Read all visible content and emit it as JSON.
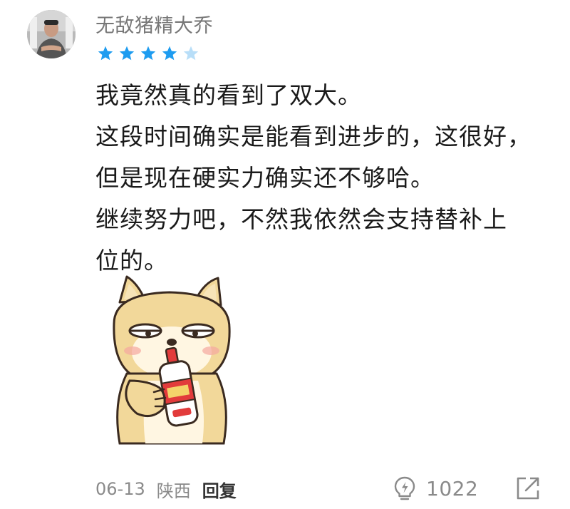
{
  "user": {
    "name": "无敌猪精大乔",
    "rating": 4,
    "max_rating": 5
  },
  "comment": {
    "lines": [
      "我竟然真的看到了双大。",
      "这段时间确实是能看到进步的，这很好，",
      "但是现在硬实力确实还不够哈。",
      "继续努力吧，不然我依然会支持替补上",
      "位的。"
    ]
  },
  "sticker": {
    "icon": "shiba-drinking-sticker"
  },
  "footer": {
    "date": "06-13",
    "location": "陕西",
    "reply_label": "回复",
    "like_count": "1022"
  },
  "colors": {
    "star_filled": "#1e9cf0",
    "star_empty": "#b8def8",
    "meta_text": "#8a8a8a"
  }
}
